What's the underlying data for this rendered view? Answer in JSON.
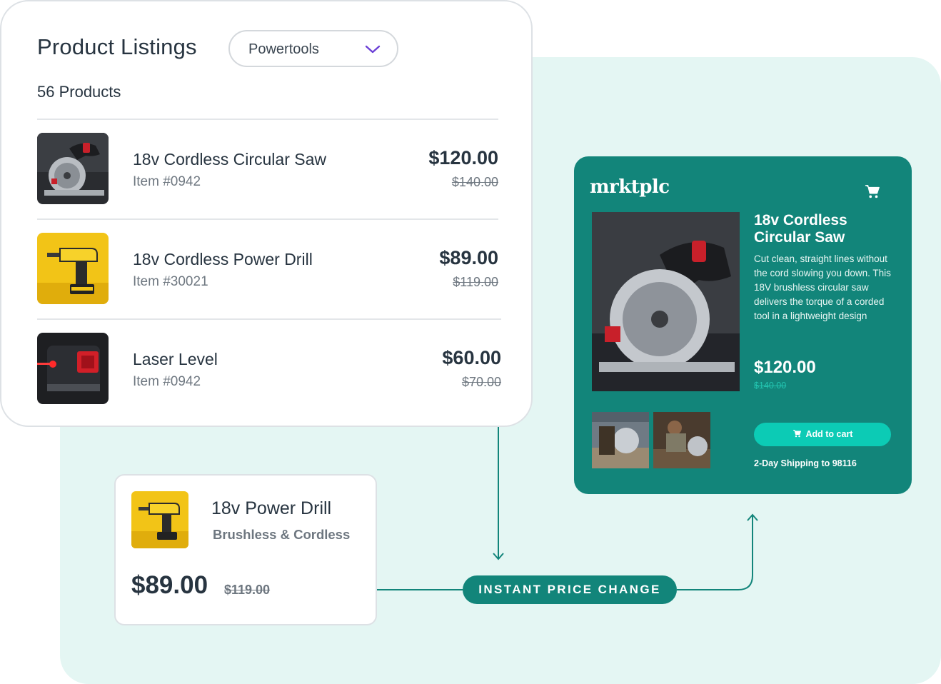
{
  "listings": {
    "title": "Product Listings",
    "filter": {
      "selected": "Powertools"
    },
    "count": "56 Products",
    "products": [
      {
        "name": "18v Cordless Circular Saw",
        "item": "Item #0942",
        "price": "$120.00",
        "old_price": "$140.00",
        "image": "circular-saw"
      },
      {
        "name": "18v Cordless Power Drill",
        "item": "Item #30021",
        "price": "$89.00",
        "old_price": "$119.00",
        "image": "power-drill"
      },
      {
        "name": "Laser Level",
        "item": "Item #0942",
        "price": "$60.00",
        "old_price": "$70.00",
        "image": "laser-level"
      }
    ]
  },
  "marketplace": {
    "logo": "mrktplc",
    "product_title": "18v Cordless Circular Saw",
    "description": "Cut clean, straight lines without the cord slowing you down. This 18V brushless circular saw delivers the torque of a corded tool in a lightweight design",
    "price": "$120.00",
    "old_price": "$140.00",
    "add_to_cart": "Add to cart",
    "shipping": "2-Day Shipping to 98116",
    "cart_icon": "cart-icon"
  },
  "mini_card": {
    "name": "18v Power Drill",
    "subtitle": "Brushless & Cordless",
    "price": "$89.00",
    "old_price": "$119.00"
  },
  "flow_label": "INSTANT PRICE CHANGE",
  "colors": {
    "teal": "#12857a",
    "teal_bright": "#0ccbb5",
    "mint_bg": "#e4f6f3",
    "text_dark": "#273440",
    "text_muted": "#6e7780",
    "chevron": "#6b3fd6"
  }
}
